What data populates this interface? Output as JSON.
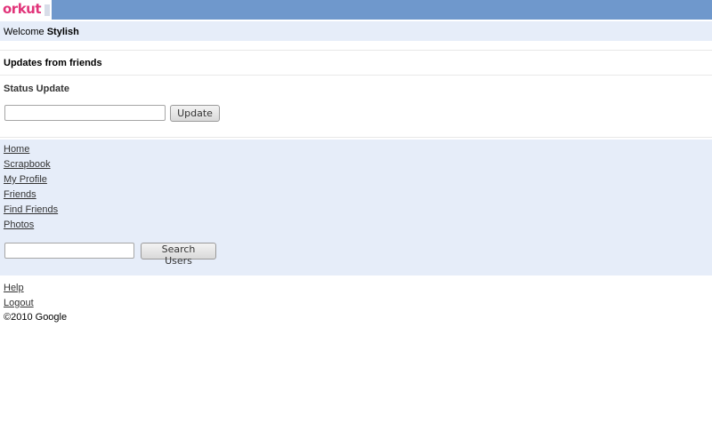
{
  "header": {
    "logo_text": "orkut"
  },
  "welcome": {
    "prefix": "Welcome",
    "username": "Stylish"
  },
  "updates": {
    "title": "Updates from friends",
    "status_label": "Status Update",
    "status_value": "",
    "update_button": "Update"
  },
  "nav": {
    "items": [
      {
        "label": "Home"
      },
      {
        "label": "Scrapbook"
      },
      {
        "label": "My Profile"
      },
      {
        "label": "Friends"
      },
      {
        "label": "Find Friends"
      },
      {
        "label": "Photos"
      }
    ],
    "search_value": "",
    "search_button": "Search Users"
  },
  "footer": {
    "help": "Help",
    "logout": "Logout",
    "copyright": "©2010 Google"
  },
  "colors": {
    "header_blue": "#6f98cc",
    "light_band": "#e6edf9",
    "logo_pink": "#e1357a"
  }
}
